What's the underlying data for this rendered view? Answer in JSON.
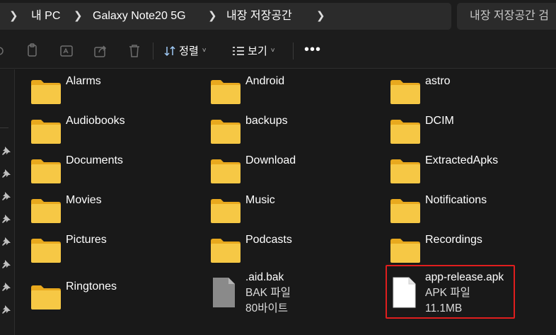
{
  "breadcrumb": {
    "items": [
      {
        "label": "내 PC"
      },
      {
        "label": "Galaxy Note20 5G"
      },
      {
        "label": "내장 저장공간"
      }
    ]
  },
  "search": {
    "placeholder": "내장 저장공간 검"
  },
  "toolbar": {
    "sort_label": "정렬",
    "view_label": "보기",
    "more_label": "•••"
  },
  "folders": [
    {
      "name": "Alarms"
    },
    {
      "name": "Android"
    },
    {
      "name": "astro"
    },
    {
      "name": "Audiobooks"
    },
    {
      "name": "backups"
    },
    {
      "name": "DCIM"
    },
    {
      "name": "Documents"
    },
    {
      "name": "Download"
    },
    {
      "name": "ExtractedApks"
    },
    {
      "name": "Movies"
    },
    {
      "name": "Music"
    },
    {
      "name": "Notifications"
    },
    {
      "name": "Pictures"
    },
    {
      "name": "Podcasts"
    },
    {
      "name": "Recordings"
    },
    {
      "name": "Ringtones"
    }
  ],
  "files": [
    {
      "name": ".aid.bak",
      "type": "BAK 파일",
      "size": "80바이트",
      "icon": "generic-file-icon"
    },
    {
      "name": "app-release.apk",
      "type": "APK 파일",
      "size": "11.1MB",
      "icon": "blank-file-icon"
    }
  ],
  "colors": {
    "folder": "#f6c845",
    "folder_dark": "#e8a91e",
    "highlight": "#e01e1e",
    "background": "#191919"
  }
}
